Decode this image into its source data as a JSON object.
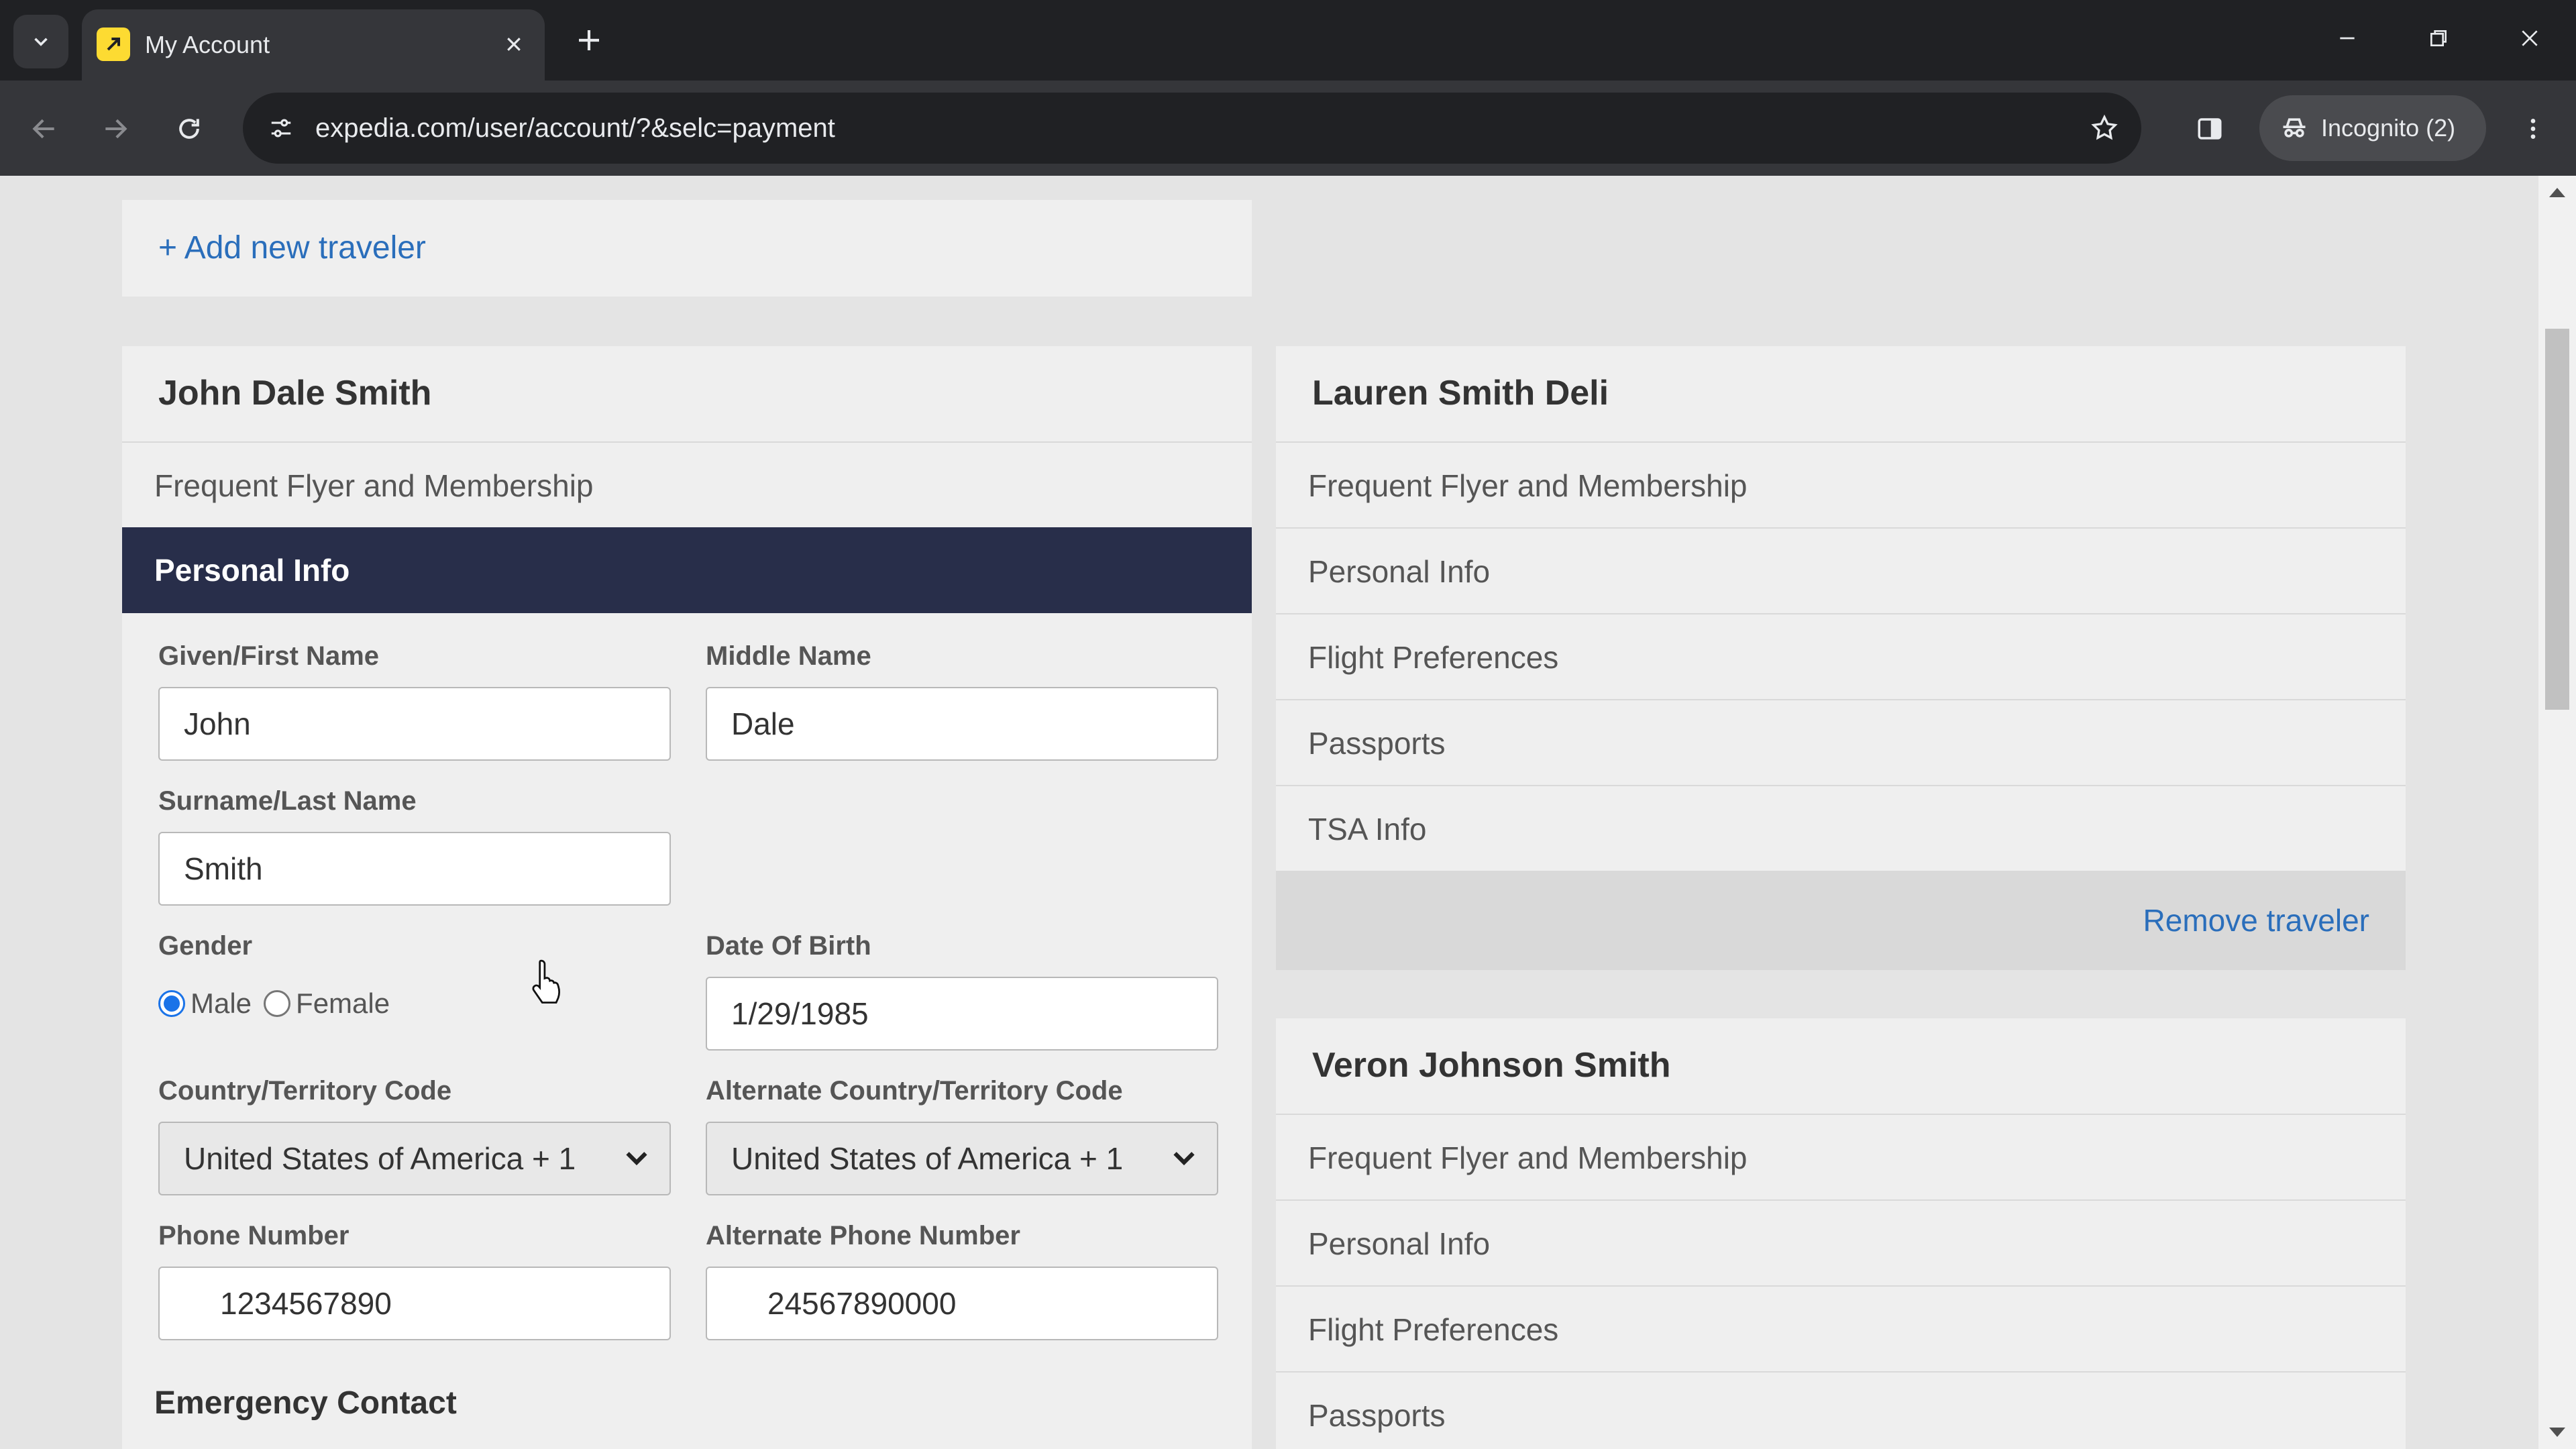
{
  "browser": {
    "tab_title": "My Account",
    "url": "expedia.com/user/account/?&selc=payment",
    "incognito_label": "Incognito (2)"
  },
  "page": {
    "add_traveler_label": "+ Add new traveler",
    "primary_traveler": {
      "name": "John Dale Smith",
      "sections": [
        "Frequent Flyer and Membership"
      ],
      "active_section": "Personal Info",
      "form": {
        "first_name_label": "Given/First Name",
        "first_name_value": "John",
        "middle_name_label": "Middle Name",
        "middle_name_value": "Dale",
        "last_name_label": "Surname/Last Name",
        "last_name_value": "Smith",
        "gender_label": "Gender",
        "gender_options": [
          "Male",
          "Female"
        ],
        "gender_selected": "Male",
        "dob_label": "Date Of Birth",
        "dob_value": "1/29/1985",
        "country_code_label": "Country/Territory Code",
        "country_code_value": "United States of America + 1",
        "alt_country_code_label": "Alternate Country/Territory Code",
        "alt_country_code_value": "United States of America + 1",
        "phone_label": "Phone Number",
        "phone_value": "1234567890",
        "alt_phone_label": "Alternate Phone Number",
        "alt_phone_value": "24567890000",
        "emergency_contact_heading": "Emergency Contact"
      }
    },
    "other_travelers": [
      {
        "name": "Lauren Smith Deli",
        "sections": [
          "Frequent Flyer and Membership",
          "Personal Info",
          "Flight Preferences",
          "Passports",
          "TSA Info"
        ],
        "remove_label": "Remove traveler"
      },
      {
        "name": "Veron Johnson Smith",
        "sections": [
          "Frequent Flyer and Membership",
          "Personal Info",
          "Flight Preferences",
          "Passports"
        ]
      }
    ]
  },
  "colors": {
    "active_section_bg": "#282e4a",
    "link": "#2a6ebb",
    "favicon": "#fddb32"
  }
}
